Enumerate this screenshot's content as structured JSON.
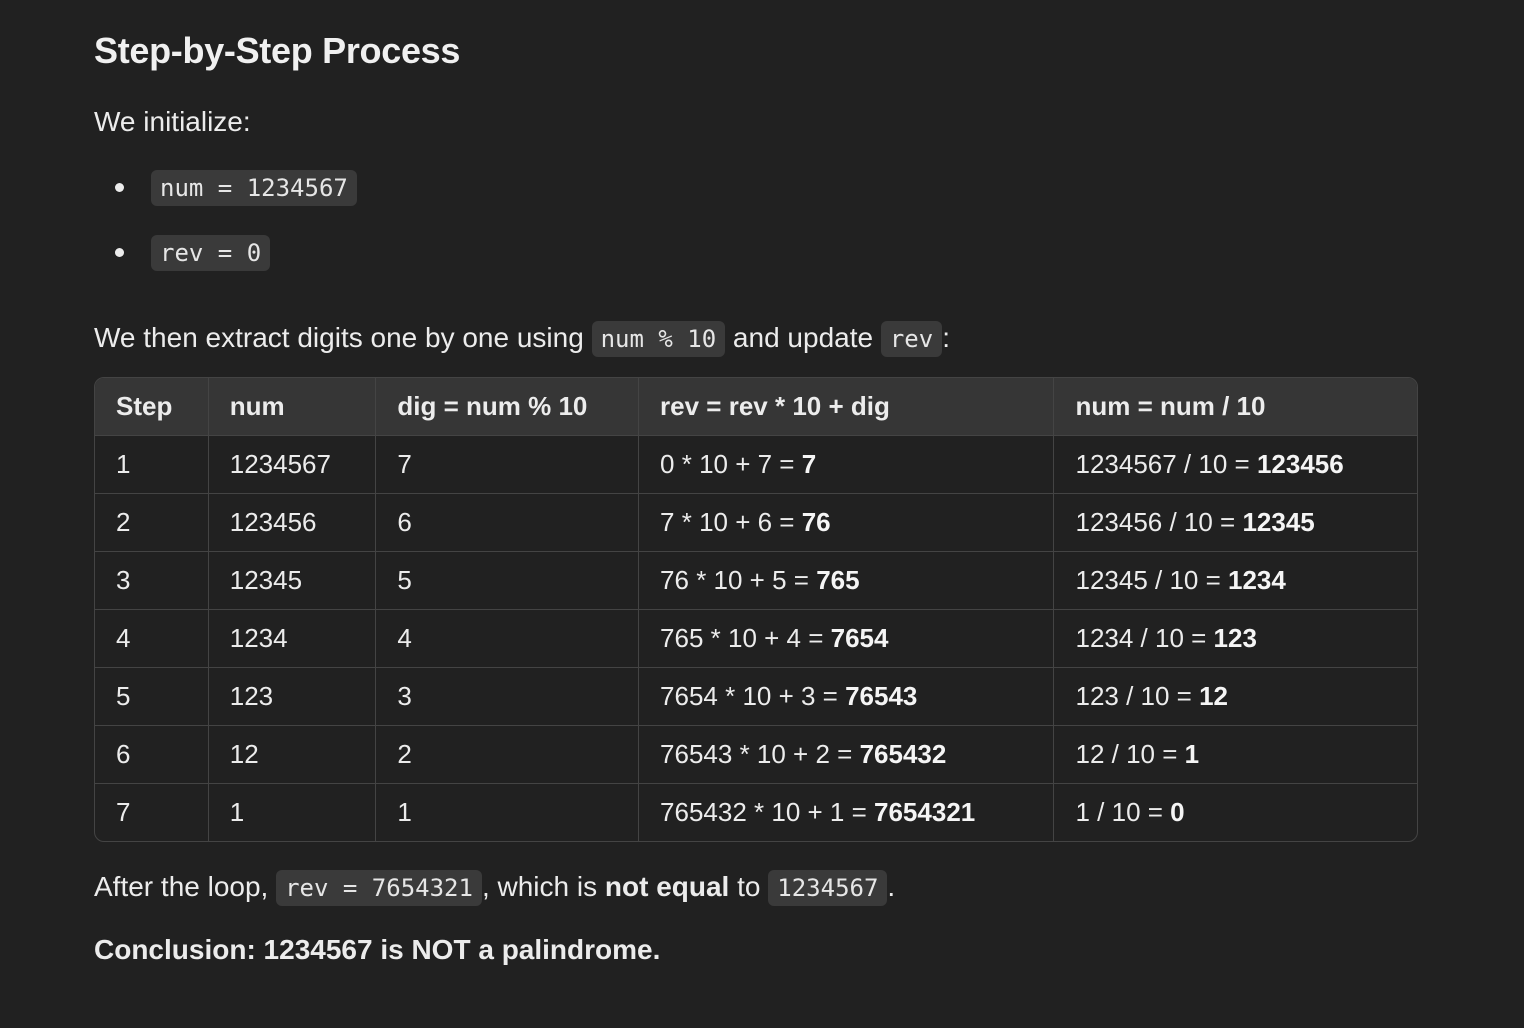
{
  "heading": "Step-by-Step Process",
  "intro": "We initialize:",
  "init_items": [
    "num = 1234567",
    "rev = 0"
  ],
  "extract": {
    "before": "We then extract digits one by one using ",
    "code1": "num % 10",
    "middle": " and update ",
    "code2": "rev",
    "after": ":"
  },
  "table": {
    "headers": [
      "Step",
      "num",
      "dig = num % 10",
      "rev = rev * 10 + dig",
      "num = num / 10"
    ],
    "rows": [
      {
        "step": "1",
        "num": "1234567",
        "dig": "7",
        "rev_expr": "0 * 10 + 7 = ",
        "rev_val": "7",
        "div_expr": "1234567 / 10 = ",
        "div_val": "123456"
      },
      {
        "step": "2",
        "num": "123456",
        "dig": "6",
        "rev_expr": "7 * 10 + 6 = ",
        "rev_val": "76",
        "div_expr": "123456 / 10 = ",
        "div_val": "12345"
      },
      {
        "step": "3",
        "num": "12345",
        "dig": "5",
        "rev_expr": "76 * 10 + 5 = ",
        "rev_val": "765",
        "div_expr": "12345 / 10 = ",
        "div_val": "1234"
      },
      {
        "step": "4",
        "num": "1234",
        "dig": "4",
        "rev_expr": "765 * 10 + 4 = ",
        "rev_val": "7654",
        "div_expr": "1234 / 10 = ",
        "div_val": "123"
      },
      {
        "step": "5",
        "num": "123",
        "dig": "3",
        "rev_expr": "7654 * 10 + 3 = ",
        "rev_val": "76543",
        "div_expr": "123 / 10 = ",
        "div_val": "12"
      },
      {
        "step": "6",
        "num": "12",
        "dig": "2",
        "rev_expr": "76543 * 10 + 2 = ",
        "rev_val": "765432",
        "div_expr": "12 / 10 = ",
        "div_val": "1"
      },
      {
        "step": "7",
        "num": "1",
        "dig": "1",
        "rev_expr": "765432 * 10 + 1 = ",
        "rev_val": "7654321",
        "div_expr": "1 / 10 = ",
        "div_val": "0"
      }
    ]
  },
  "after_loop": {
    "before": "After the loop, ",
    "code1": "rev = 7654321",
    "middle": ", which is ",
    "bold": "not equal",
    "to": " to ",
    "code2": "1234567",
    "end": "."
  },
  "conclusion": "Conclusion: 1234567 is NOT a palindrome."
}
